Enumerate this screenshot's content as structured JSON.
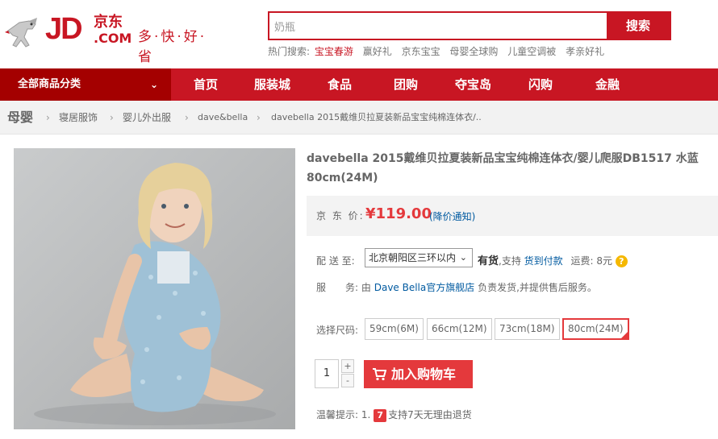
{
  "logo": {
    "jd": "JD",
    "cn": "京东",
    "com": ".COM",
    "slogan": "多·快·好·省"
  },
  "search": {
    "value": "奶瓶",
    "button": "搜索"
  },
  "hot": {
    "label": "热门搜索:",
    "items": [
      "宝宝春游",
      "赢好礼",
      "京东宝宝",
      "母婴全球购",
      "儿童空调被",
      "孝亲好礼"
    ]
  },
  "nav": {
    "all_label": "全部商品分类",
    "items": [
      "首页",
      "服装城",
      "食品",
      "团购",
      "夺宝岛",
      "闪购",
      "金融"
    ]
  },
  "breadcrumb": [
    "母婴",
    "寝居服饰",
    "婴儿外出服",
    "dave&bella",
    "davebella 2015戴维贝拉夏装新品宝宝纯棉连体衣/.."
  ],
  "product": {
    "title": "davebella 2015戴维贝拉夏装新品宝宝纯棉连体衣/婴儿爬服DB1517 水蓝 80cm(24M)",
    "price_label": "京 东 价:",
    "price": "¥119.00",
    "price_notify": "(降价通知)",
    "delivery_label": "配 送 至:",
    "delivery_region": "北京朝阳区三环以内",
    "stock": "有货",
    "support_text": ",支持",
    "cod": "货到付款",
    "freight_label": "运费:",
    "freight": "8元",
    "service_label": "服　　务:",
    "service_from": "由",
    "shop": "Dave Bella官方旗舰店",
    "service_rest": "负责发货,并提供售后服务。",
    "size_label": "选择尺码:",
    "sizes": [
      "59cm(6M)",
      "66cm(12M)",
      "73cm(18M)",
      "80cm(24M)"
    ],
    "selected_size": "80cm(24M)",
    "quantity": "1",
    "add_to_cart": "加入购物车",
    "tip_label": "温馨提示:",
    "tip_index": "1.",
    "tip_badge": "7",
    "tip_text": "支持7天无理由退货"
  },
  "colors": {
    "brand": "#c81623",
    "price": "#e4393c",
    "link": "#005aa0"
  }
}
